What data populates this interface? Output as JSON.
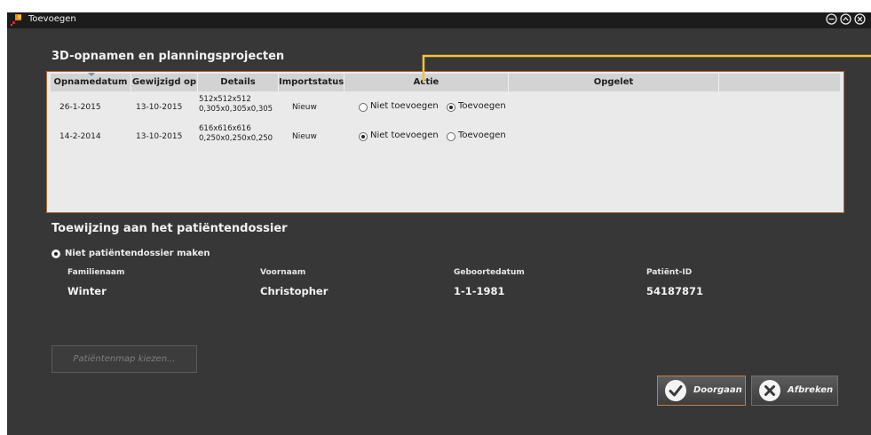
{
  "window": {
    "title": "Toevoegen"
  },
  "recordings": {
    "title": "3D-opnamen en planningsprojecten",
    "columns": [
      "Opnamedatum",
      "Gewijzigd op",
      "Details",
      "Importstatus",
      "Actie",
      "Opgelet",
      ""
    ],
    "rows": [
      {
        "date": "26-1-2015",
        "modified": "13-10-2015",
        "details_line1": "512x512x512",
        "details_line2": "0,305x0,305x0,305",
        "status": "Nieuw",
        "selected": "add"
      },
      {
        "date": "14-2-2014",
        "modified": "13-10-2015",
        "details_line1": "616x616x616",
        "details_line2": "0,250x0,250x0,250",
        "status": "Nieuw",
        "selected": "skip"
      }
    ],
    "option_skip": "Niet toevoegen",
    "option_add": "Toevoegen"
  },
  "assignment": {
    "title": "Toewijzing aan het patiëntendossier",
    "option": "Niet patiëntendossier maken",
    "labels": {
      "lastname": "Familienaam",
      "firstname": "Voornaam",
      "birthdate": "Geboortedatum",
      "patient_id": "Patiënt-ID"
    },
    "values": {
      "lastname": "Winter",
      "firstname": "Christopher",
      "birthdate": "1-1-1981",
      "patient_id": "54187871"
    }
  },
  "buttons": {
    "choose_folder": "Patiëntenmap kiezen...",
    "continue": "Doorgaan",
    "cancel": "Afbreken"
  },
  "colors": {
    "accent": "#f2c434",
    "selection_border": "#b06a3c",
    "window_bg": "#373737"
  },
  "icons": {
    "app": "app-icon",
    "minimize": "minimize-icon",
    "restore": "restore-icon",
    "close": "close-icon",
    "continue": "checkmark-icon",
    "cancel": "cross-icon"
  }
}
